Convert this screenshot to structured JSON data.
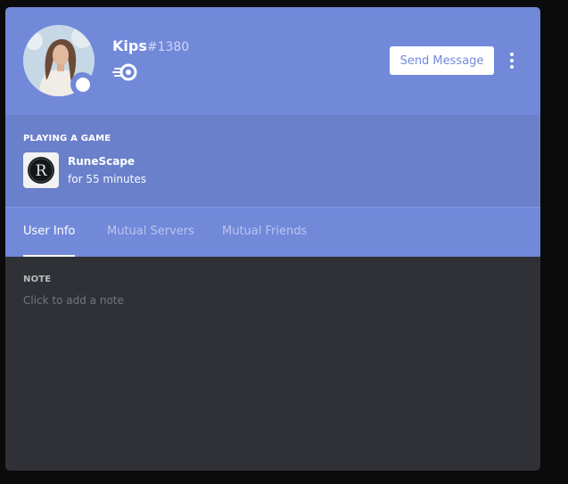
{
  "profile": {
    "username": "Kips",
    "discriminator": "#1380",
    "avatar_icon": "user-avatar-photo",
    "status_color": "#ffffff",
    "badge_icon": "nitro-badge-icon",
    "send_message_label": "Send Message"
  },
  "activity": {
    "heading": "PLAYING A GAME",
    "game_name": "RuneScape",
    "duration": "for 55 minutes",
    "game_icon": "runescape-logo-icon"
  },
  "tabs": [
    {
      "label": "User Info",
      "active": true
    },
    {
      "label": "Mutual Servers",
      "active": false
    },
    {
      "label": "Mutual Friends",
      "active": false
    }
  ],
  "note": {
    "label": "NOTE",
    "placeholder": "Click to add a note"
  },
  "colors": {
    "blurple": "#7289da",
    "background": "#2f3136"
  }
}
